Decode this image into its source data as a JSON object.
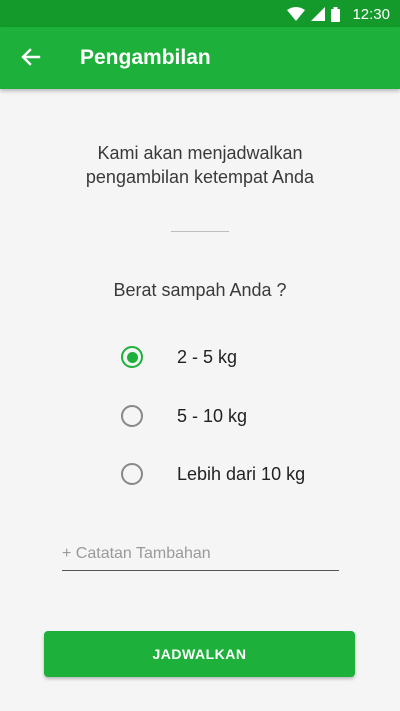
{
  "status_bar": {
    "time": "12:30",
    "icons": [
      "wifi-icon",
      "cell-signal-icon",
      "battery-icon"
    ]
  },
  "app_bar": {
    "title": "Pengambilan",
    "back_icon": "arrow-left-icon"
  },
  "main": {
    "intro_line1": "Kami akan menjadwalkan",
    "intro_line2": "pengambilan ketempat Anda",
    "question": "Berat sampah Anda ?",
    "weight_options": [
      {
        "label": "2 - 5 kg",
        "selected": true
      },
      {
        "label": "5 - 10 kg",
        "selected": false
      },
      {
        "label": "Lebih dari 10 kg",
        "selected": false
      }
    ],
    "notes_placeholder": "+ Catatan Tambahan",
    "notes_value": "",
    "submit_label": "JADWALKAN"
  },
  "colors": {
    "status_bar": "#149a2b",
    "app_bar": "#1db03a",
    "accent": "#1db03a",
    "background": "#f5f5f5"
  }
}
